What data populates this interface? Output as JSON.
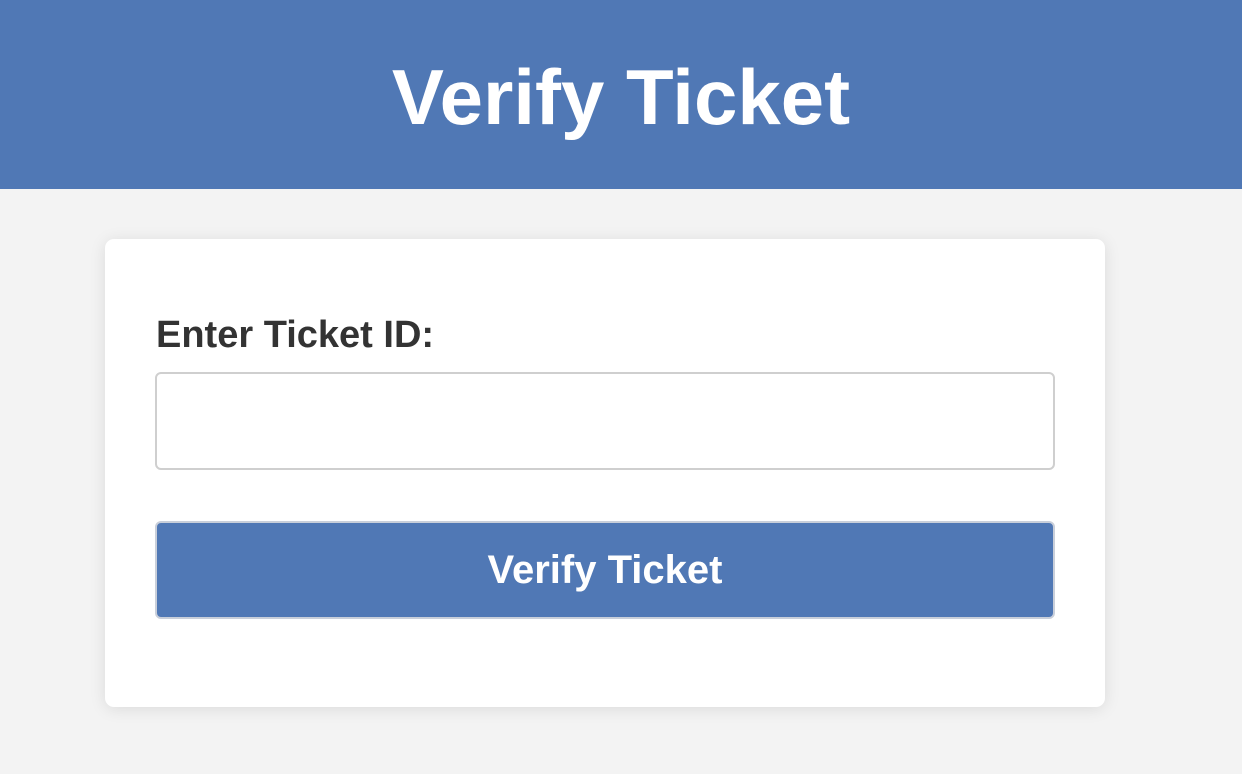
{
  "header": {
    "title": "Verify Ticket"
  },
  "form": {
    "label": "Enter Ticket ID:",
    "input_value": "",
    "input_placeholder": "",
    "submit_label": "Verify Ticket"
  },
  "colors": {
    "primary": "#5078b5",
    "background": "#f3f3f3",
    "card": "#ffffff",
    "label_text": "#333333"
  }
}
